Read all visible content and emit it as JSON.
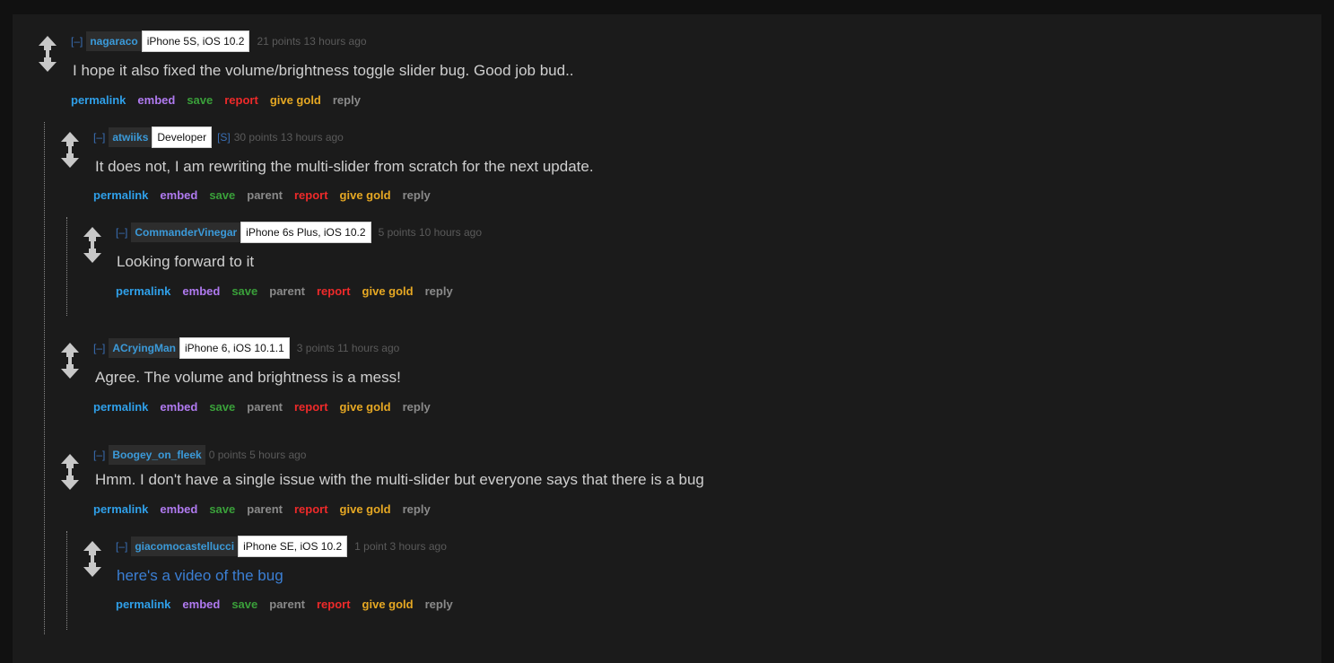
{
  "collapse_label": "[–]",
  "submitter_label": "[S]",
  "buttons": {
    "permalink": "permalink",
    "embed": "embed",
    "save": "save",
    "parent": "parent",
    "report": "report",
    "give_gold": "give gold",
    "reply": "reply"
  },
  "comments": [
    {
      "author": "nagaraco",
      "flair": "iPhone 5S, iOS 10.2",
      "meta": "21 points 13 hours ago",
      "body": "I hope it also fixed the volume/brightness toggle slider bug. Good job bud.."
    },
    {
      "author": "atwiiks",
      "flair": "Developer",
      "submitter": true,
      "meta": "30 points 13 hours ago",
      "body": "It does not, I am rewriting the multi-slider from scratch for the next update."
    },
    {
      "author": "CommanderVinegar",
      "flair": "iPhone 6s Plus, iOS 10.2",
      "meta": "5 points 10 hours ago",
      "body": "Looking forward to it"
    },
    {
      "author": "ACryingMan",
      "flair": "iPhone 6, iOS 10.1.1",
      "meta": "3 points 11 hours ago",
      "body": "Agree. The volume and brightness is a mess!"
    },
    {
      "author": "Boogey_on_fleek",
      "flair": "",
      "meta": "0 points 5 hours ago",
      "body": "Hmm. I don't have a single issue with the multi-slider but everyone says that there is a bug"
    },
    {
      "author": "giacomocastellucci",
      "flair": "iPhone SE, iOS 10.2",
      "meta": "1 point 3 hours ago",
      "body_link": "here's a video of the bug"
    }
  ],
  "colors": {
    "background": "#1b1b1b",
    "author": "#3b9ad9",
    "permalink": "#2f9fe8",
    "embed": "#b07af0",
    "save": "#3aa03a",
    "report": "#ee2a2a",
    "give_gold": "#e6a823",
    "link": "#3b7fd4"
  }
}
